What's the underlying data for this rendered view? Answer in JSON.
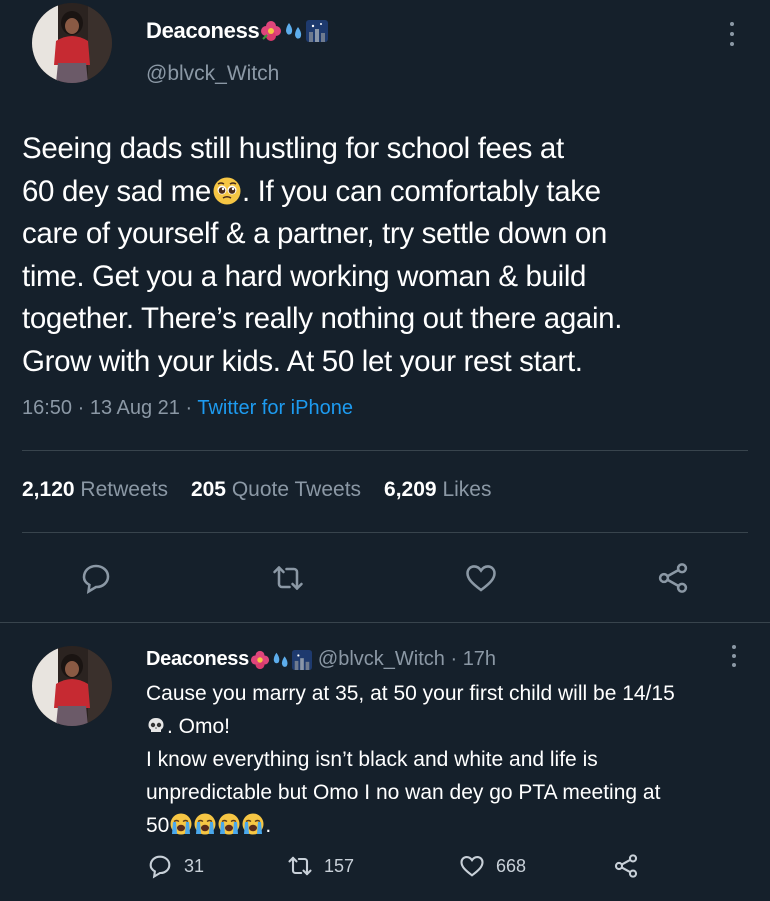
{
  "tweet": {
    "display_name": "Deaconess",
    "name_emojis": [
      "hibiscus",
      "sweat-droplets",
      "night-city"
    ],
    "handle": "@blvck_Witch",
    "text_lines": [
      "Seeing dads still hustling for school fees at",
      "60 dey sad me",
      ". If you can comfortably take",
      "care of yourself & a partner, try settle down on",
      "time. Get you a hard working woman & build",
      "together. There’s really nothing out there again.",
      "Grow with your kids. At 50 let your rest start."
    ],
    "inline_emoji": "pleading-face",
    "time": "16:50 · 13 Aug 21 · ",
    "source": "Twitter for iPhone",
    "stats": [
      {
        "count": "2,120",
        "label": "Retweets"
      },
      {
        "count": "205",
        "label": "Quote Tweets"
      },
      {
        "count": "6,209",
        "label": "Likes"
      }
    ],
    "actions": [
      "reply-icon",
      "retweet-icon",
      "like-icon",
      "share-icon"
    ]
  },
  "reply": {
    "display_name": "Deaconess",
    "handle_time": "@blvck_Witch · 17h",
    "line1": "Cause you marry at 35, at 50 your first child will be 14/15",
    "line2": ". Omo!",
    "line3": "I know everything isn’t black and white and life is",
    "line4": "unpredictable but Omo I no wan dey go PTA meeting at",
    "line5_prefix": "50",
    "line5_suffix": ".",
    "emojis": [
      "skull",
      "loudly-crying-face"
    ],
    "reply_count": "31",
    "retweet_count": "157",
    "like_count": "668"
  },
  "colors": {
    "background": "#15202b",
    "text": "#ffffff",
    "muted": "#8b98a5",
    "link": "#1d9bf0",
    "divider": "#38444d"
  }
}
